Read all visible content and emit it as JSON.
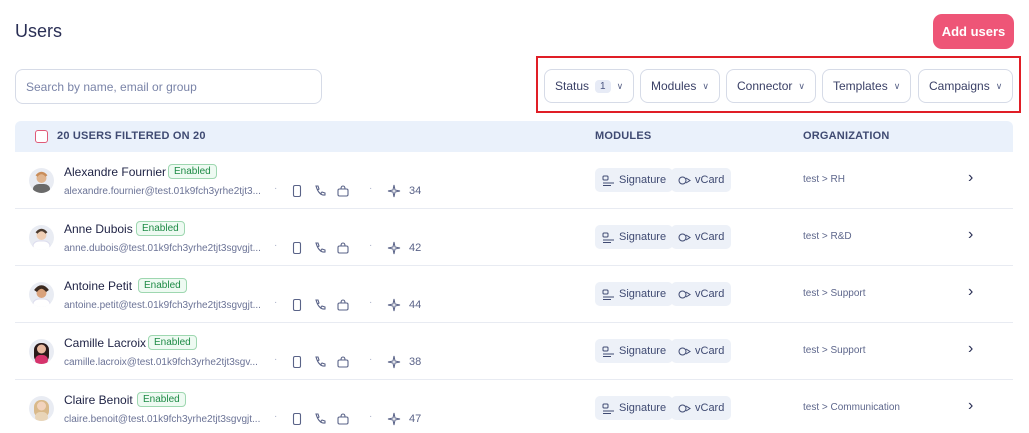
{
  "header": {
    "title": "Users",
    "add_users_label": "Add users"
  },
  "search": {
    "placeholder": "Search by name, email or group",
    "value": ""
  },
  "filters": [
    {
      "label": "Status",
      "count": "1"
    },
    {
      "label": "Modules"
    },
    {
      "label": "Connector"
    },
    {
      "label": "Templates"
    },
    {
      "label": "Campaigns"
    }
  ],
  "table": {
    "filtered_label": "20 USERS FILTERED ON 20",
    "columns": {
      "modules": "MODULES",
      "organization": "ORGANIZATION"
    },
    "rows": [
      {
        "name": "Alexandre Fournier",
        "status": "Enabled",
        "email": "alexandre.fournier@test.01k9fch3yrhe2tjt3...",
        "score": "34",
        "modules": [
          "Signature",
          "vCard"
        ],
        "organization": "test > RH",
        "avatar_color": "#c98d5a"
      },
      {
        "name": "Anne Dubois",
        "status": "Enabled",
        "email": "anne.dubois@test.01k9fch3yrhe2tjt3sgvgjt...",
        "score": "42",
        "modules": [
          "Signature",
          "vCard"
        ],
        "organization": "test > R&D",
        "avatar_color": "#4a3a2e"
      },
      {
        "name": "Antoine Petit",
        "status": "Enabled",
        "email": "antoine.petit@test.01k9fch3yrhe2tjt3sgvgjt...",
        "score": "44",
        "modules": [
          "Signature",
          "vCard"
        ],
        "organization": "test > Support",
        "avatar_color": "#3b2a20"
      },
      {
        "name": "Camille Lacroix",
        "status": "Enabled",
        "email": "camille.lacroix@test.01k9fch3yrhe2tjt3sgv...",
        "score": "38",
        "modules": [
          "Signature",
          "vCard"
        ],
        "organization": "test > Support",
        "avatar_color": "#2a1a1a"
      },
      {
        "name": "Claire Benoit",
        "status": "Enabled",
        "email": "claire.benoit@test.01k9fch3yrhe2tjt3sgvgjt...",
        "score": "47",
        "modules": [
          "Signature",
          "vCard"
        ],
        "organization": "test > Communication",
        "avatar_color": "#d9b98a"
      }
    ]
  },
  "icons": {
    "checkbox": "checkbox-icon",
    "chevron": "chevron-down-icon",
    "row_arrow": "chevron-right-icon",
    "device": "tablet-icon",
    "phone": "phone-icon",
    "connector": "cloud-icon",
    "score": "sparkle-icon",
    "signature": "signature-icon",
    "vcard": "vcard-icon"
  },
  "colors": {
    "accent": "#ee5577",
    "highlight": "#e01e26",
    "enabled": "#1d8a45",
    "header_bg": "#eaf1fb"
  }
}
